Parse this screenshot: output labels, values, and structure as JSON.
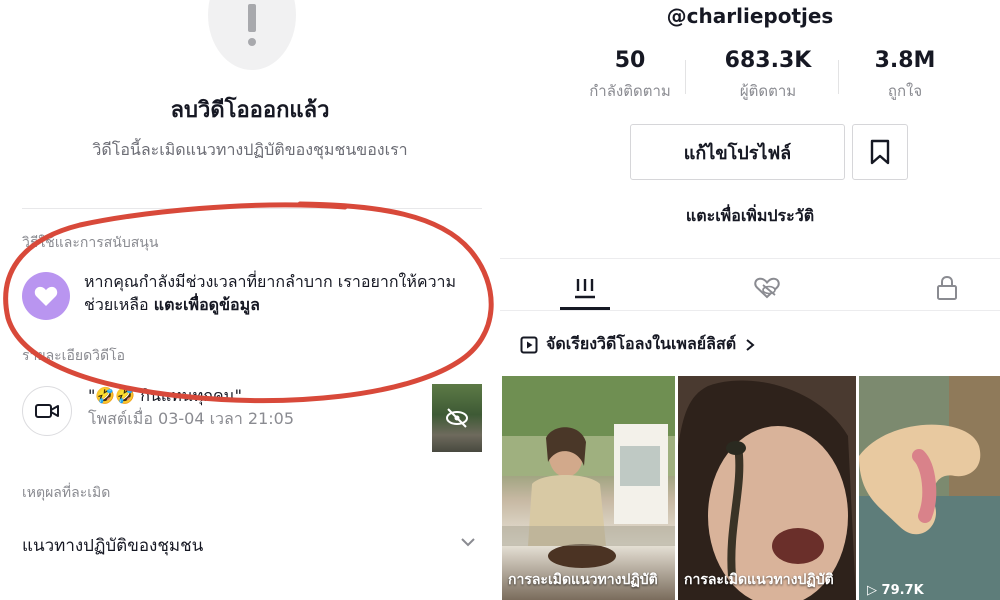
{
  "left": {
    "title": "ลบวิดีโอออกแล้ว",
    "description": "วิดีโอนี้ละเมิดแนวทางปฏิบัติของชุมชนของเรา",
    "support_section_label": "วิธีใช้และการสนับสนุน",
    "support_text": "หากคุณกำลังมีช่วงเวลาที่ยากลำบาก เราอยากให้ความช่วยเหลือ",
    "support_link": "แตะเพื่อดูข้อมูล",
    "details_section_label": "รายละเอียดวิดีโอ",
    "video_caption": "\"🤣🤣 กินแทนทุกคน\"",
    "video_posted": "โพสต์เมื่อ 03-04 เวลา 21:05",
    "violation_section_label": "เหตุผลที่ละเมิด",
    "violation_reason": "แนวทางปฏิบัติของชุมชน"
  },
  "right": {
    "username": "@charliepotjes",
    "stats": [
      {
        "value": "50",
        "label": "กำลังติดตาม"
      },
      {
        "value": "683.3K",
        "label": "ผู้ติดตาม"
      },
      {
        "value": "3.8M",
        "label": "ถูกใจ"
      }
    ],
    "edit_profile_label": "แก้ไขโปรไฟล์",
    "add_bio_label": "แตะเพื่อเพิ่มประวัติ",
    "playlist_label": "จัดเรียงวิดีโอลงในเพลย์ลิสต์",
    "videos": [
      {
        "label": "การละเมิดแนวทางปฏิบัติ"
      },
      {
        "label": "การละเมิดแนวทางปฏิบัติ"
      },
      {
        "views": "79.7K"
      }
    ]
  },
  "colors": {
    "annotation_red": "#d8493a",
    "heart_badge": "#b995f0",
    "text_primary": "#161823",
    "text_secondary": "#8a8b91"
  },
  "icons": [
    "alert-icon",
    "heart-icon",
    "video-camera-icon",
    "hidden-eye-icon",
    "chevron-down-icon",
    "bookmark-icon",
    "grid-icon",
    "liked-hidden-icon",
    "lock-icon",
    "playlist-icon",
    "chevron-right-icon",
    "play-icon"
  ]
}
